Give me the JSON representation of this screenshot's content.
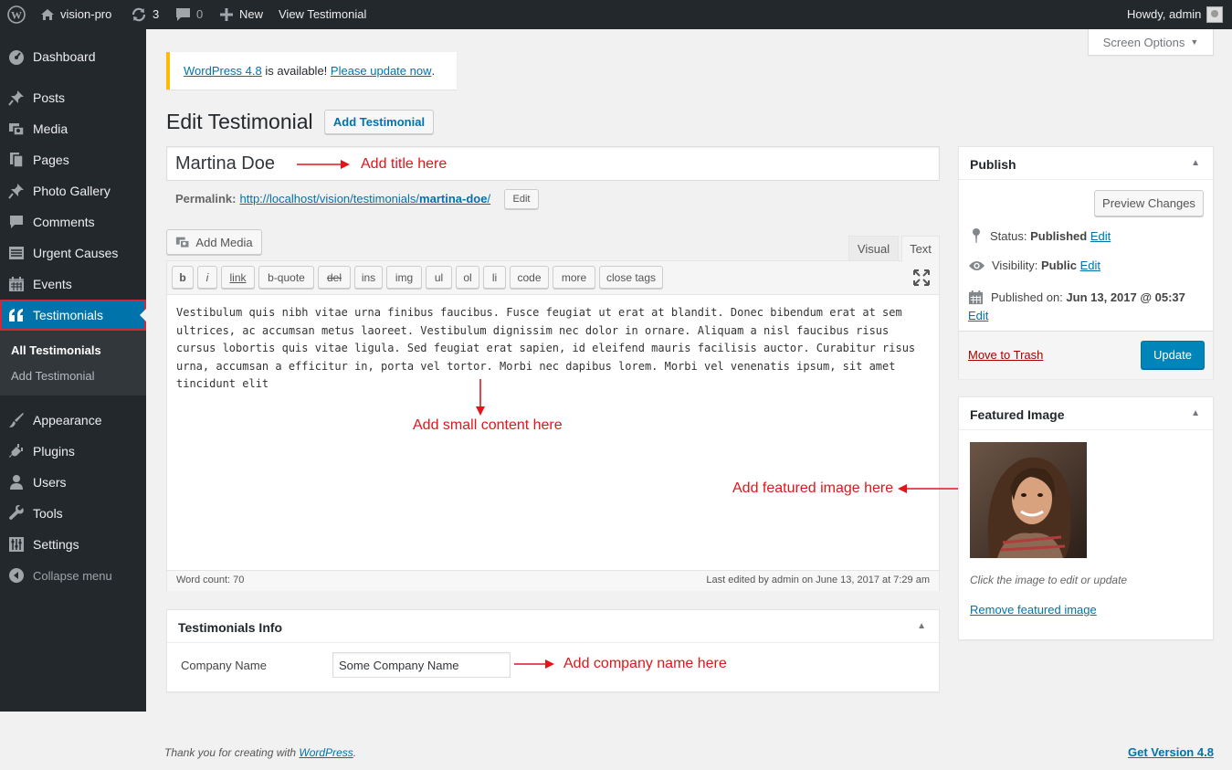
{
  "admin_bar": {
    "site_name": "vision-pro",
    "updates_count": "3",
    "comments_count": "0",
    "new_label": "New",
    "view_label": "View Testimonial",
    "howdy": "Howdy, admin"
  },
  "sidebar": {
    "items": [
      {
        "label": "Dashboard",
        "icon": "dashboard-icon"
      },
      {
        "label": "Posts",
        "icon": "pin-icon"
      },
      {
        "label": "Media",
        "icon": "media-icon"
      },
      {
        "label": "Pages",
        "icon": "pages-icon"
      },
      {
        "label": "Photo Gallery",
        "icon": "pin-icon"
      },
      {
        "label": "Comments",
        "icon": "comment-icon"
      },
      {
        "label": "Urgent Causes",
        "icon": "list-icon"
      },
      {
        "label": "Events",
        "icon": "calendar-icon"
      },
      {
        "label": "Testimonials",
        "icon": "quote-icon"
      },
      {
        "label": "Appearance",
        "icon": "brush-icon"
      },
      {
        "label": "Plugins",
        "icon": "plug-icon"
      },
      {
        "label": "Users",
        "icon": "user-icon"
      },
      {
        "label": "Tools",
        "icon": "wrench-icon"
      },
      {
        "label": "Settings",
        "icon": "settings-icon"
      },
      {
        "label": "Collapse menu",
        "icon": "collapse-icon"
      }
    ],
    "submenu": [
      "All Testimonials",
      "Add Testimonial"
    ]
  },
  "screen_options": "Screen Options",
  "notice": {
    "link1": "WordPress 4.8",
    "middle": " is available! ",
    "link2": "Please update now",
    "end": "."
  },
  "page": {
    "title": "Edit Testimonial",
    "add_button": "Add Testimonial"
  },
  "post": {
    "title": "Martina Doe",
    "permalink_label": "Permalink:",
    "permalink_base": "http://localhost/vision/testimonials/",
    "permalink_slug": "martina-doe",
    "permalink_end": "/",
    "edit_label": "Edit"
  },
  "editor": {
    "add_media": "Add Media",
    "tab_visual": "Visual",
    "tab_text": "Text",
    "quicktags": [
      "b",
      "i",
      "link",
      "b-quote",
      "del",
      "ins",
      "img",
      "ul",
      "ol",
      "li",
      "code",
      "more",
      "close tags"
    ],
    "content": "Vestibulum quis nibh vitae urna finibus faucibus. Fusce feugiat ut erat at blandit. Donec bibendum erat at sem ultrices, ac accumsan metus laoreet. Vestibulum dignissim nec dolor in ornare. Aliquam a nisl faucibus risus cursus lobortis quis vitae ligula. Sed feugiat erat sapien, id eleifend mauris facilisis auctor. Curabitur risus urna, accumsan a efficitur in, porta vel tortor. Morbi nec dapibus lorem. Morbi vel venenatis ipsum, sit amet tincidunt elit",
    "word_count": "Word count: 70",
    "last_edited": "Last edited by admin on June 13, 2017 at 7:29 am"
  },
  "testimonial_info": {
    "title": "Testimonials Info",
    "company_label": "Company Name",
    "company_value": "Some Company Name"
  },
  "publish": {
    "title": "Publish",
    "preview": "Preview Changes",
    "status_label": "Status:",
    "status_value": "Published",
    "visibility_label": "Visibility:",
    "visibility_value": "Public",
    "published_label": "Published on:",
    "published_value": "Jun 13, 2017 @ 05:37",
    "edit": "Edit",
    "trash": "Move to Trash",
    "update": "Update"
  },
  "featured": {
    "title": "Featured Image",
    "hint": "Click the image to edit or update",
    "remove": "Remove featured image"
  },
  "annotations": {
    "title": "Add title here",
    "content": "Add small content here",
    "image": "Add featured image here",
    "company": "Add company name here"
  },
  "footer": {
    "thanks_pre": "Thank you for creating with ",
    "thanks_link": "WordPress",
    "thanks_end": ".",
    "version": "Get Version 4.8"
  },
  "colors": {
    "admin_bar": "#23282d",
    "accent": "#0073aa",
    "highlight_border": "#d1273b",
    "annotation": "#e2151b",
    "notice_border": "#ffb900"
  }
}
